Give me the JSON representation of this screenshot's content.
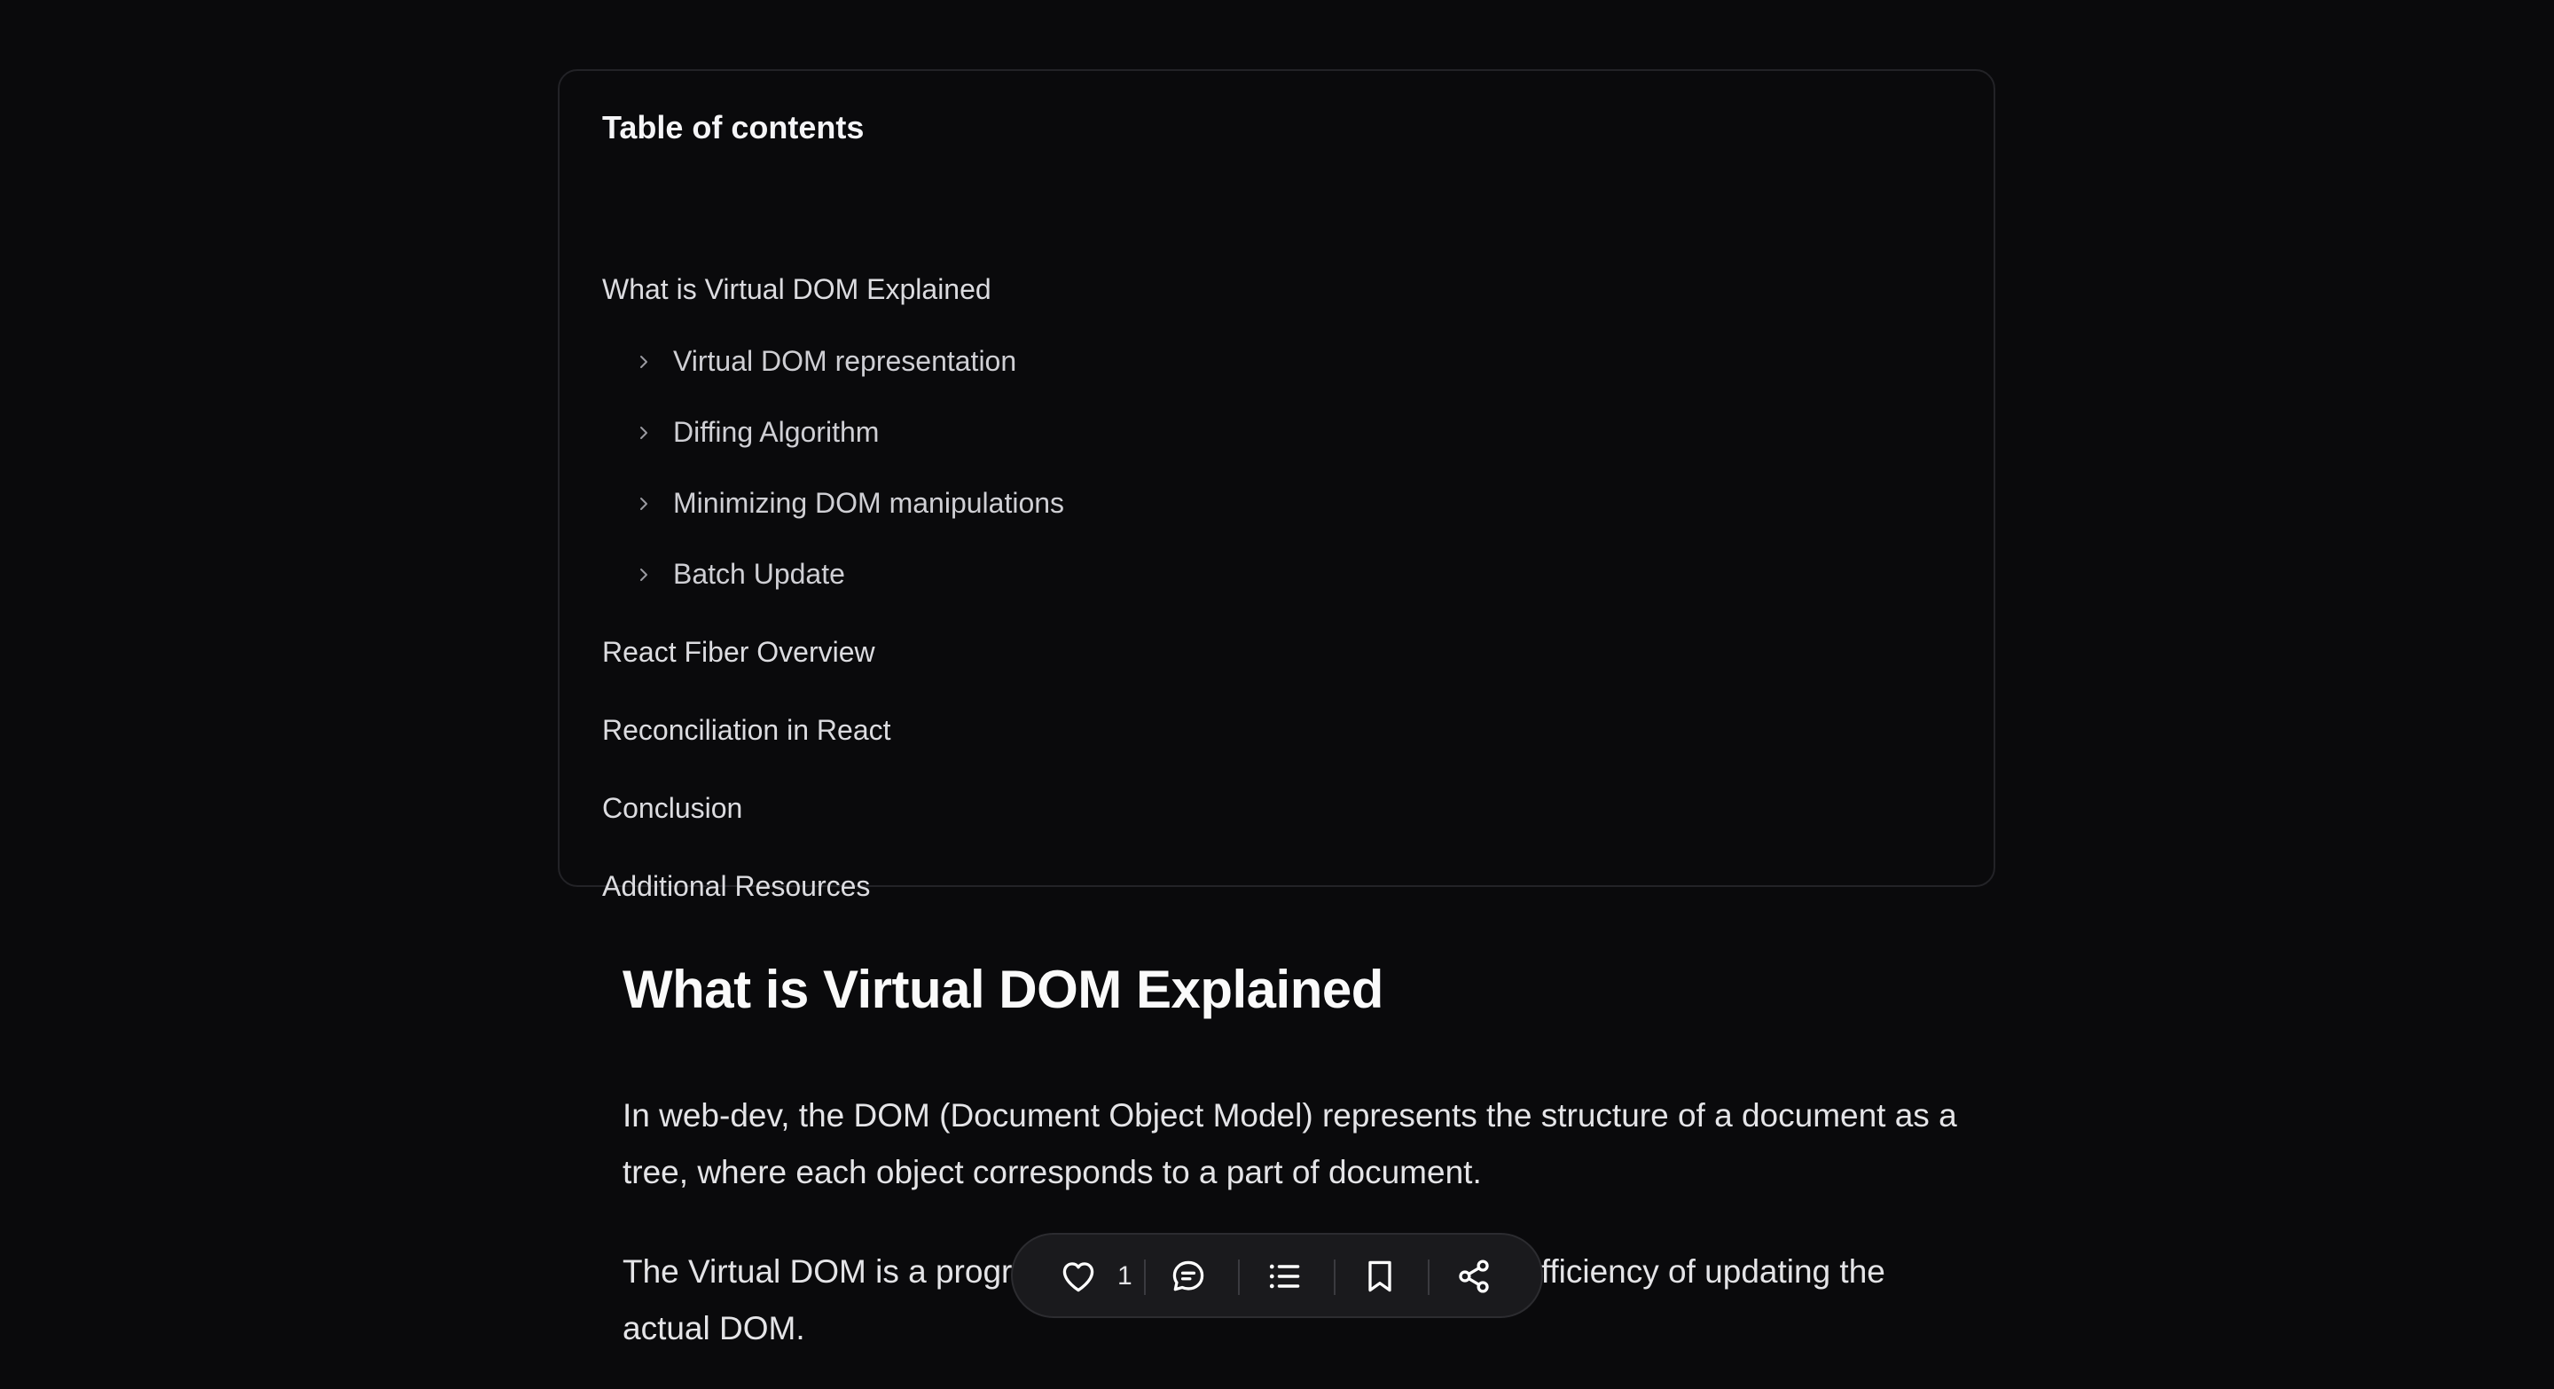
{
  "toc": {
    "title": "Table of contents",
    "items": [
      {
        "label": "What is Virtual DOM Explained",
        "level": 1
      },
      {
        "label": "Virtual DOM representation",
        "level": 2
      },
      {
        "label": "Diffing Algorithm",
        "level": 2
      },
      {
        "label": "Minimizing DOM manipulations",
        "level": 2
      },
      {
        "label": "Batch Update",
        "level": 2
      },
      {
        "label": "React Fiber Overview",
        "level": 1
      },
      {
        "label": "Reconciliation in React",
        "level": 1
      },
      {
        "label": "Conclusion",
        "level": 1
      },
      {
        "label": "Additional Resources",
        "level": 1
      }
    ]
  },
  "article": {
    "heading": "What is Virtual DOM Explained",
    "paragraphs": [
      "In web-dev, the DOM (Document Object Model) represents the structure of a document as a tree, where each object corresponds to a part of document.",
      "The Virtual DOM is a programming concept that improves the efficiency of updating the actual DOM."
    ]
  },
  "action_bar": {
    "like_count": "1",
    "icons": [
      "heart-icon",
      "comment-icon",
      "list-icon",
      "bookmark-icon",
      "share-icon"
    ]
  },
  "colors": {
    "background": "#0a0a0c",
    "card_border": "#232327",
    "text": "#ebebed",
    "action_bar_bg": "#1a1a1d"
  }
}
